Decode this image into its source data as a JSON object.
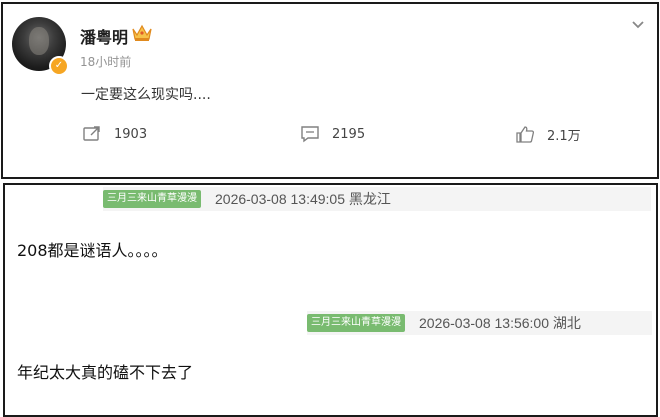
{
  "post": {
    "username": "潘粤明",
    "time": "18小时前",
    "text": "一定要这么现实吗....",
    "actions": [
      {
        "icon": "repost-icon",
        "count": "1903"
      },
      {
        "icon": "comment-icon",
        "count": "2195"
      },
      {
        "icon": "like-icon",
        "count": "2.1万"
      }
    ]
  },
  "comments": [
    {
      "user_tag": "三月三来山青草漫漫",
      "meta": "2026-03-08 13:49:05 黑龙江",
      "text": "208都是谜语人。。。。"
    },
    {
      "user_tag": "三月三来山青草漫漫",
      "meta": "2026-03-08 13:56:00 湖北",
      "text": "年纪太大真的磕不下去了"
    }
  ],
  "colors": {
    "tag_green": "#79bb70",
    "badge_orange": "#f6a623",
    "border": "#1a1a1a"
  }
}
